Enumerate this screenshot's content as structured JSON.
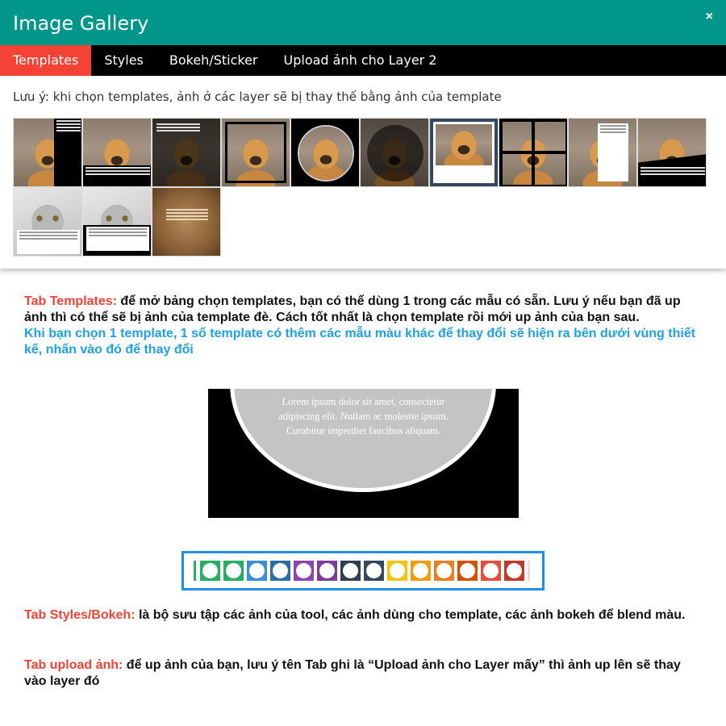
{
  "dialog": {
    "title": "Image Gallery",
    "close_label": "×",
    "tabs": [
      {
        "label": "Templates",
        "active": true
      },
      {
        "label": "Styles",
        "active": false
      },
      {
        "label": "Bokeh/Sticker",
        "active": false
      },
      {
        "label": "Upload ảnh cho Layer 2",
        "active": false
      }
    ],
    "note": "Lưu ý: khi chọn templates, ảnh ở các layer sẽ bị thay thế bằng ảnh của template",
    "thumbnail_count": 13
  },
  "instructions": {
    "templates_heading": "Tab Templates:",
    "templates_text": " để mở bảng chọn templates, bạn có thể dùng 1 trong các mẫu có sẵn. Lưu ý nếu bạn đã up ảnh thì có thể sẽ bị ảnh của template đè. Cách tốt nhất là chọn template rồi mới up ảnh của bạn sau.",
    "templates_note": "Khi bạn chọn 1 template, 1 số template có thêm các mẫu màu khác để thay đổi sẽ hiện ra bên dưới vùng thiết kế, nhấn vào đó để thay đổi",
    "styles_heading": "Tab Styles/Bokeh:",
    "styles_text": " là bộ sưu tập các ảnh của tool, các ảnh dùng cho template, các ảnh bokeh để blend màu.",
    "upload_heading": "Tab upload ảnh:",
    "upload_text": " để up ảnh của bạn, lưu ý tên Tab ghi là “Upload ảnh cho Layer mấy” thì ảnh up lên sẽ thay vào layer đó"
  },
  "preview": {
    "text_lines": [
      "Lorem ipsum dolor sit amet, consectetur",
      "adipiscing elit. Nullam ac molestie ipsum.",
      "Curabitur imperdiet faucibus aliquam."
    ]
  },
  "swatches": {
    "colors": [
      "#27ae60",
      "#27ae60",
      "#3a8fd6",
      "#2e6da4",
      "#8e44ad",
      "#7d3c98",
      "#2c3e50",
      "#34495e",
      "#f1c40f",
      "#f39c12",
      "#e67e22",
      "#d35400",
      "#e74c3c",
      "#c0392b"
    ]
  }
}
